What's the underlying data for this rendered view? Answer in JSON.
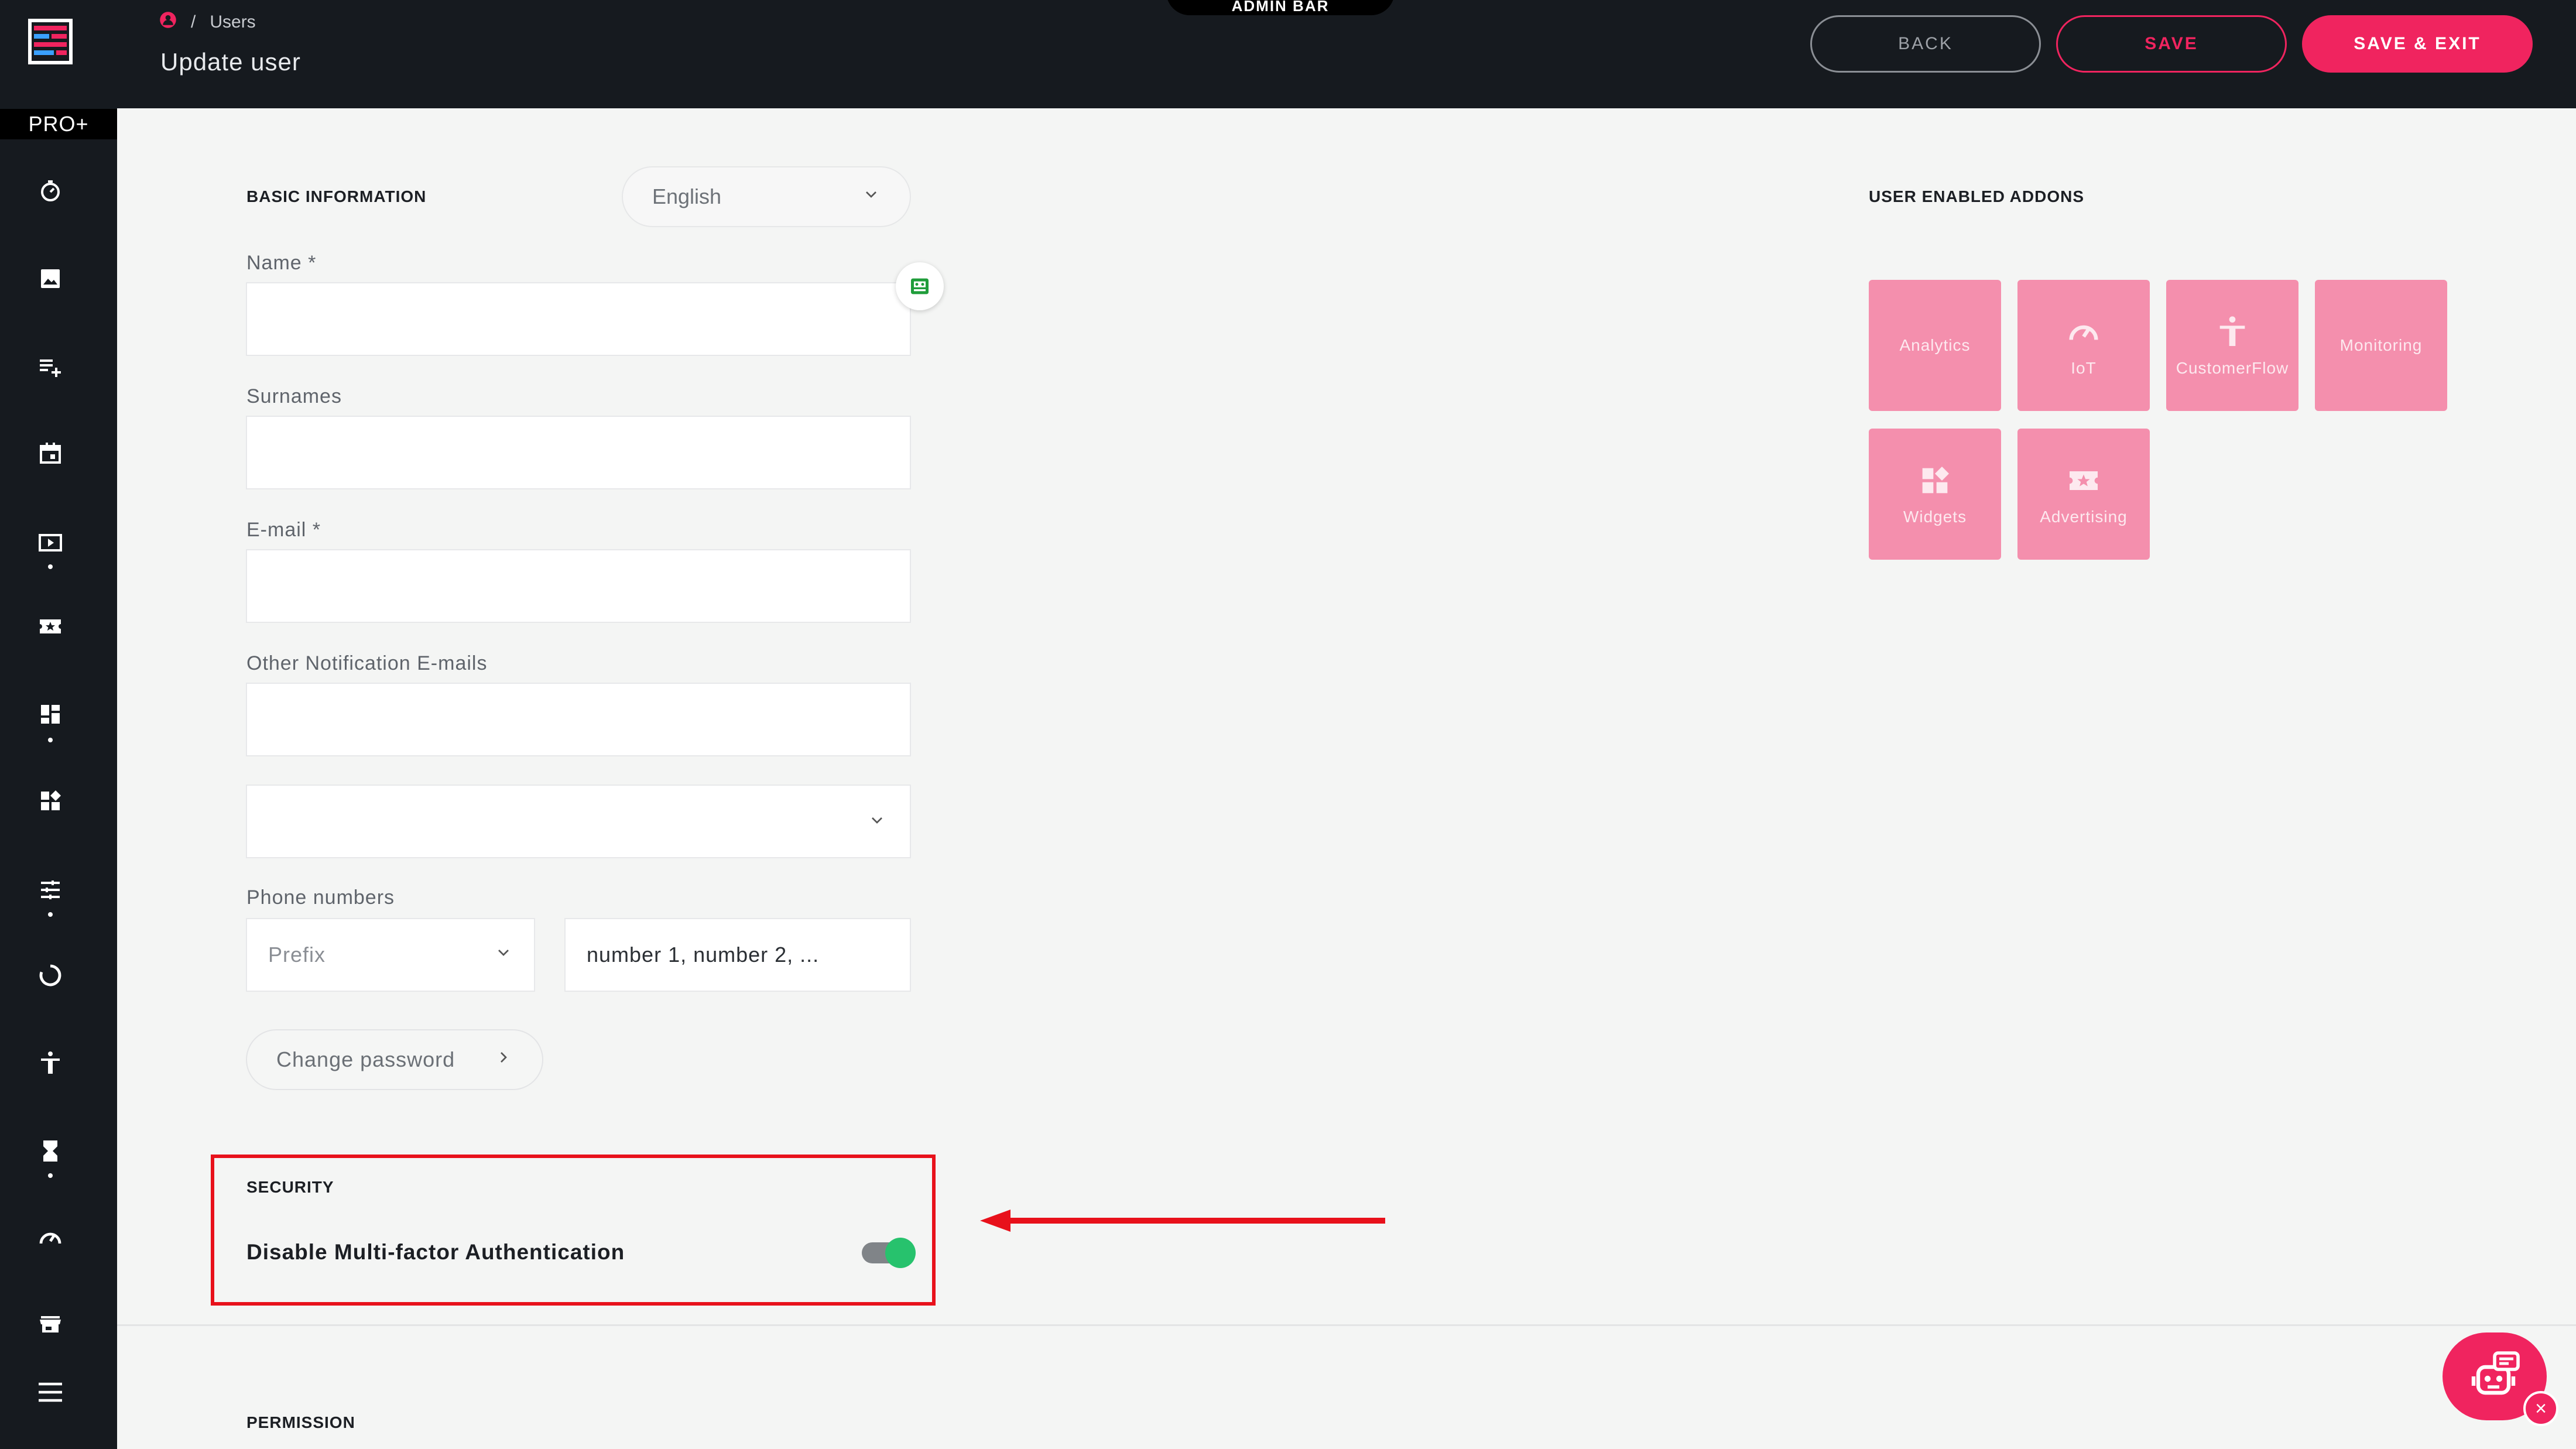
{
  "sidebar": {
    "plan_badge": "PRO+",
    "items": [
      {
        "icon": "timer-icon"
      },
      {
        "icon": "image-icon"
      },
      {
        "icon": "playlist-add-icon"
      },
      {
        "icon": "calendar-icon"
      },
      {
        "icon": "tv-play-icon"
      },
      {
        "icon": "ticket-star-icon"
      },
      {
        "icon": "dashboard-icon"
      },
      {
        "icon": "widgets-icon"
      },
      {
        "icon": "sliders-icon"
      },
      {
        "icon": "refresh-icon"
      },
      {
        "icon": "accessibility-icon"
      },
      {
        "icon": "hourglass-icon"
      },
      {
        "icon": "speedometer-icon"
      },
      {
        "icon": "store-icon"
      },
      {
        "icon": "menu-icon"
      }
    ]
  },
  "header": {
    "breadcrumb": {
      "separator": "/",
      "current": "Users"
    },
    "title": "Update user",
    "admin_tab": "ADMIN BAR",
    "buttons": {
      "back": "BACK",
      "save": "SAVE",
      "save_exit": "SAVE & EXIT"
    }
  },
  "basic_info": {
    "section_title": "BASIC INFORMATION",
    "language": "English",
    "name_label": "Name *",
    "surnames_label": "Surnames",
    "email_label": "E-mail *",
    "other_emails_label": "Other Notification E-mails",
    "select_value": "",
    "phone_label": "Phone numbers",
    "prefix_placeholder": "Prefix",
    "phone_placeholder": "number 1, number 2, ...",
    "change_password": "Change password"
  },
  "addons": {
    "section_title": "USER ENABLED ADDONS",
    "items": [
      {
        "label": "Analytics",
        "icon": ""
      },
      {
        "label": "IoT",
        "icon": "speedometer-icon"
      },
      {
        "label": "CustomerFlow",
        "icon": "accessibility-icon"
      },
      {
        "label": "Monitoring",
        "icon": ""
      },
      {
        "label": "Widgets",
        "icon": "widgets-icon"
      },
      {
        "label": "Advertising",
        "icon": "ticket-star-icon"
      }
    ]
  },
  "security": {
    "section_title": "SECURITY",
    "mfa_label": "Disable Multi-factor Authentication",
    "mfa_disabled": true
  },
  "permission": {
    "section_title": "PERMISSION"
  },
  "colors": {
    "accent": "#f0245f",
    "addon_tile": "#f48fad",
    "sidebar": "#161a1f",
    "toggle_on": "#27c26d",
    "annotation": "#e8111b"
  }
}
